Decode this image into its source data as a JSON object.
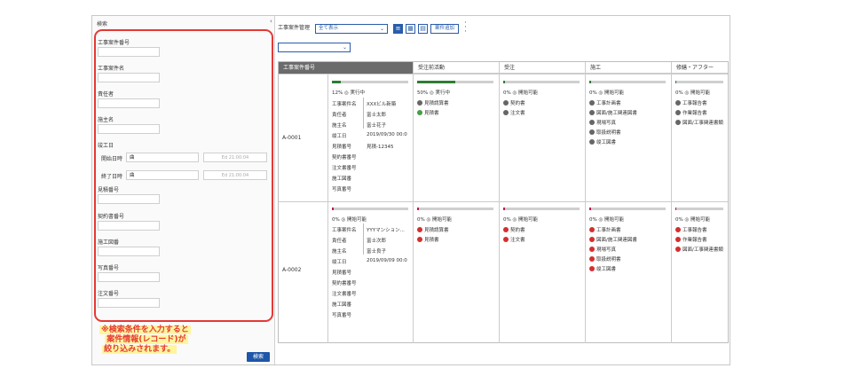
{
  "search_panel": {
    "title": "検索",
    "collapse_icon": "chevron-left-icon",
    "fields": [
      "工事案件番号",
      "工事案件名",
      "責任者",
      "施主名"
    ],
    "completion_label": "竣工日",
    "start_label": "開始日時",
    "start_value": "曲",
    "start_time_placeholder": "Ed 21:00:04",
    "end_label": "終了日時",
    "end_value": "曲",
    "end_time_placeholder": "Ed 21:00:04",
    "fields2": [
      "見積番号",
      "契約書番号",
      "施工図番",
      "写真番号",
      "注文番号"
    ],
    "note_lines": [
      "※検索条件を入力すると",
      "案件情報(レコード)が",
      "絞り込みされます。"
    ],
    "search_button": "検索"
  },
  "toolbar": {
    "label": "工事案件管理",
    "filter_value": "全て表示",
    "secondary_value": "",
    "add_button": "案件追加"
  },
  "grid": {
    "headers": [
      "工事案件番号",
      "",
      "受注前活動",
      "受注",
      "施工",
      "修繕・アフター"
    ],
    "field_labels": [
      "工事案件名",
      "責任者",
      "施主名",
      "竣工日",
      "見積番号",
      "契約書番号",
      "注文書番号",
      "施工図番",
      "写真番号"
    ],
    "rows": [
      {
        "id": "A-0001",
        "progress": 12,
        "status": "12% ◎ 実行中",
        "values": [
          "XXXビル新築",
          "富士太郎",
          "富士花子",
          "2019/09/30 00:00:...",
          "見積-12345"
        ],
        "phases": [
          {
            "progress": 50,
            "status": "50% ◎ 実行中",
            "items": [
              {
                "t": "見積請算書",
                "s": "gray"
              },
              {
                "t": "見積書",
                "s": "green"
              }
            ]
          },
          {
            "progress": 0,
            "status": "0% ◎ 開始可能",
            "items": [
              {
                "t": "契約書",
                "s": "gray"
              },
              {
                "t": "注文書",
                "s": "gray"
              }
            ]
          },
          {
            "progress": 0,
            "status": "0% ◎ 開始可能",
            "items": [
              {
                "t": "工事計画書",
                "s": "gray"
              },
              {
                "t": "図面/施工関連図書",
                "s": "gray"
              },
              {
                "t": "現場写真",
                "s": "gray"
              },
              {
                "t": "取扱説明書",
                "s": "gray"
              },
              {
                "t": "竣工図書",
                "s": "gray"
              }
            ]
          },
          {
            "progress": 0,
            "status": "0% ◎ 開始可能",
            "items": [
              {
                "t": "工事報告書",
                "s": "gray"
              },
              {
                "t": "作業報告書",
                "s": "gray"
              },
              {
                "t": "図面/工事関連書類",
                "s": "gray"
              }
            ]
          }
        ]
      },
      {
        "id": "A-0002",
        "progress": 0,
        "status": "0% ◎ 開始可能",
        "values": [
          "YYYマンション...",
          "富士次郎",
          "富士良子",
          "2019/09/09 00:00:..."
        ],
        "phases": [
          {
            "progress": 0,
            "status": "0% ◎ 開始可能",
            "items": [
              {
                "t": "見積請算書",
                "s": "red"
              },
              {
                "t": "見積書",
                "s": "red"
              }
            ]
          },
          {
            "progress": 0,
            "status": "0% ◎ 開始可能",
            "items": [
              {
                "t": "契約書",
                "s": "red"
              },
              {
                "t": "注文書",
                "s": "red"
              }
            ]
          },
          {
            "progress": 0,
            "status": "0% ◎ 開始可能",
            "items": [
              {
                "t": "工事計画書",
                "s": "red"
              },
              {
                "t": "図面/施工関連図書",
                "s": "red"
              },
              {
                "t": "現場写真",
                "s": "red"
              },
              {
                "t": "取扱説明書",
                "s": "red"
              },
              {
                "t": "竣工図書",
                "s": "red"
              }
            ]
          },
          {
            "progress": 0,
            "status": "0% ◎ 開始可能",
            "items": [
              {
                "t": "工事報告書",
                "s": "red"
              },
              {
                "t": "作業報告書",
                "s": "red"
              },
              {
                "t": "図面/工事関連書類",
                "s": "red"
              }
            ]
          }
        ]
      }
    ]
  },
  "colors": {
    "accent": "#2a5caa",
    "highlight": "#e53935",
    "done": "#43a047",
    "pending": "#d32f2f"
  }
}
